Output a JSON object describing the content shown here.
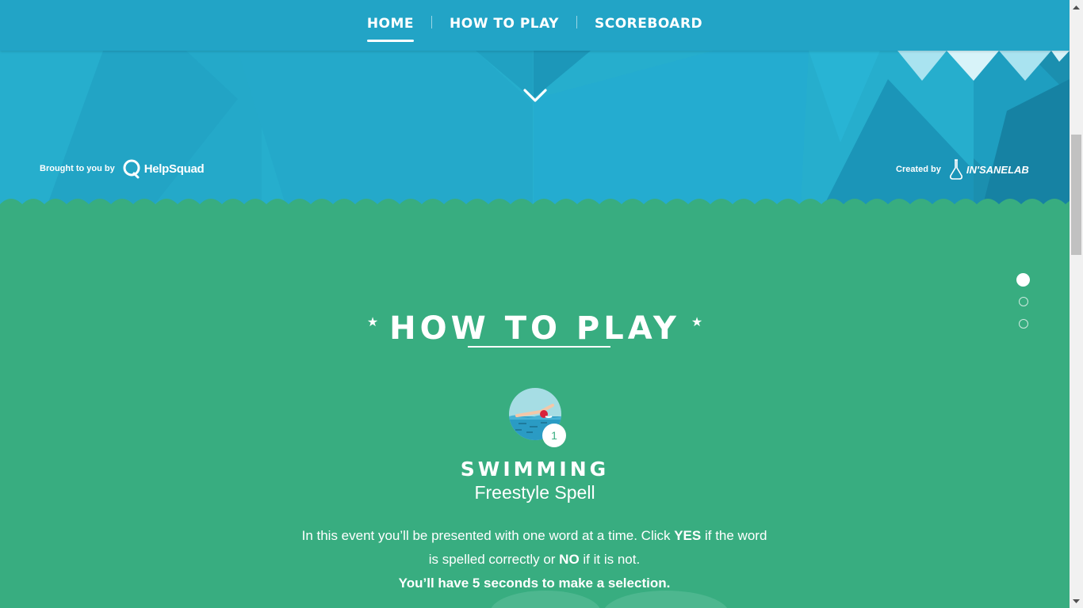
{
  "nav": {
    "items": [
      {
        "label": "HOME",
        "active": true
      },
      {
        "label": "HOW TO PLAY",
        "active": false
      },
      {
        "label": "SCOREBOARD",
        "active": false
      }
    ]
  },
  "hero": {
    "brought_label": "Brought to you by",
    "helpsquad_logo_text": "HelpSquad",
    "created_label": "Created by",
    "insanelab_logo_text": "IN'SANELAB",
    "scroll_icon": "chevron-down-icon"
  },
  "section": {
    "title": "HOW TO PLAY",
    "event_number": "1",
    "event_name": "SWIMMING",
    "event_subtitle": "Freestyle Spell",
    "desc_part1": "In this event you’ll be presented with one word at a time. Click ",
    "desc_yes": "YES",
    "desc_part2": " if the word is spelled correctly or ",
    "desc_no": "NO",
    "desc_part3": " if it is not.",
    "desc_line3": "You’ll have 5 seconds to make a selection."
  },
  "pagination": {
    "count": 3,
    "active_index": 0
  },
  "colors": {
    "sky": "#26aecd",
    "navbar": "#22a4c6",
    "grass": "#38ad80",
    "text": "#ffffff"
  }
}
